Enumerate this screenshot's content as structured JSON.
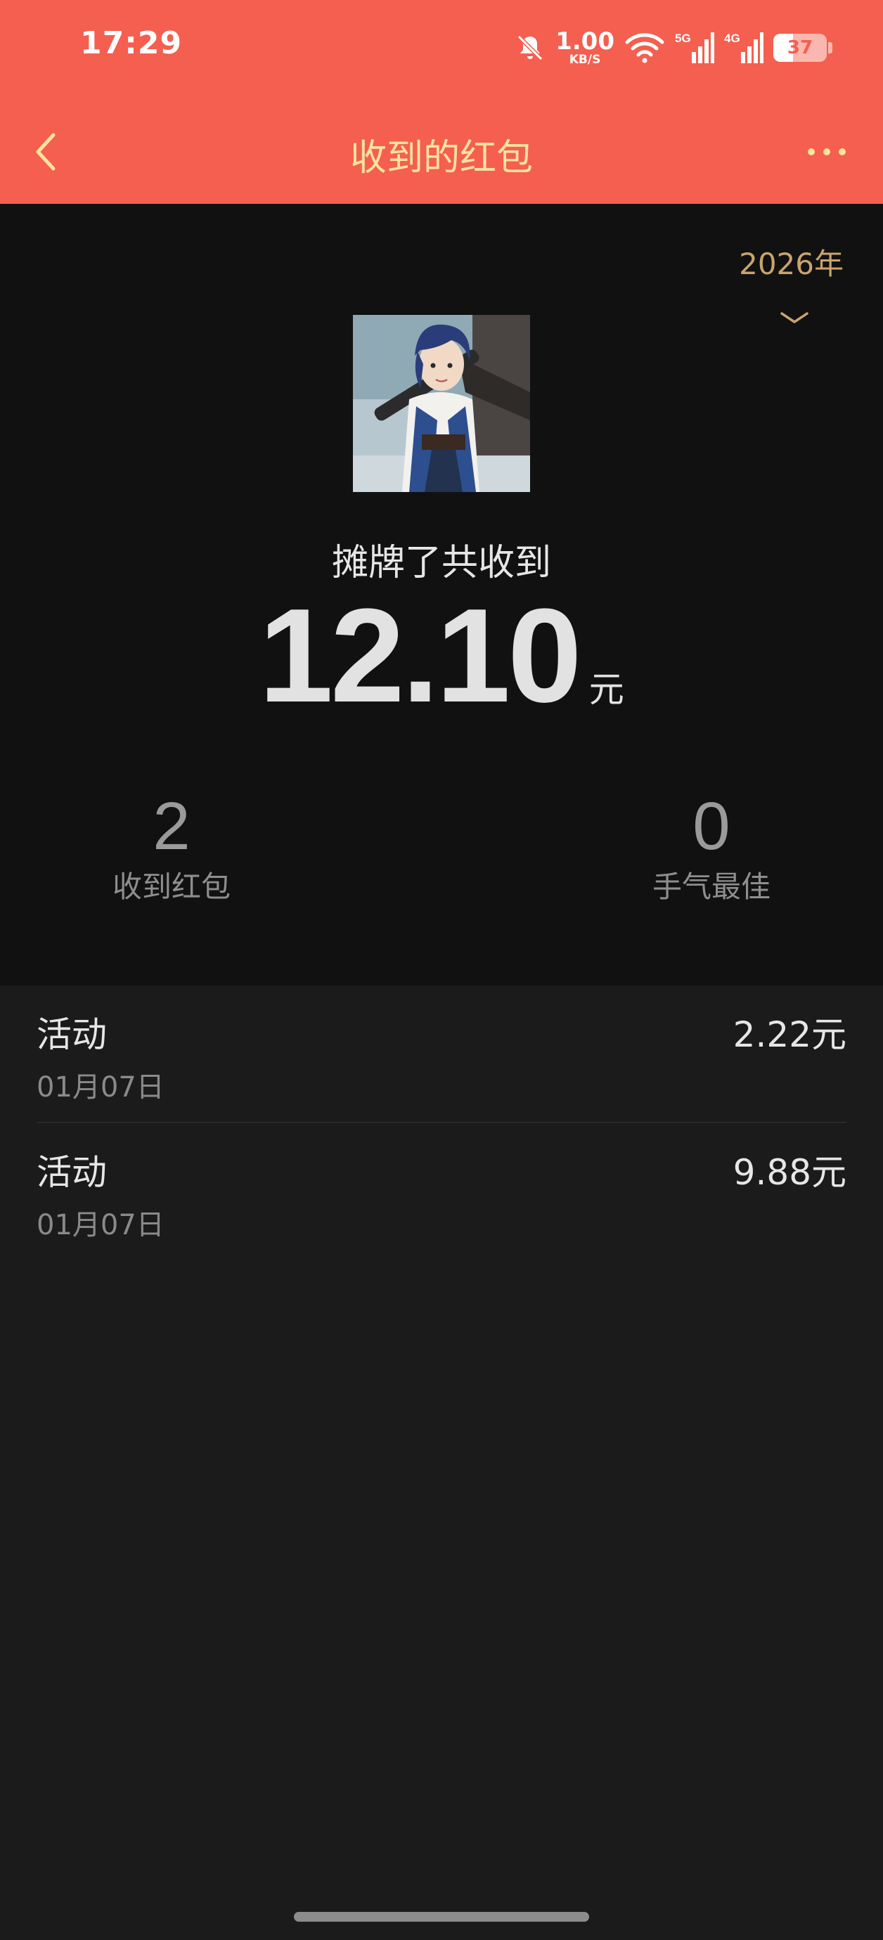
{
  "status_bar": {
    "time": "17:29",
    "net_speed": "1.00",
    "net_speed_unit": "KB/S",
    "signal_1": "5G",
    "signal_2": "4G",
    "battery": "37",
    "battery_level_percent": 37
  },
  "nav": {
    "title": "收到的红包",
    "back_icon": "chevron-left-icon",
    "more_icon": "more-dots-icon"
  },
  "summary": {
    "year": "2026年",
    "user_line": "摊牌了共收到",
    "total": "12.10",
    "unit": "元",
    "stats": [
      {
        "value": "2",
        "label": "收到红包"
      },
      {
        "value": "0",
        "label": "手气最佳"
      }
    ]
  },
  "records": [
    {
      "name": "活动",
      "date": "01月07日",
      "amount": "2.22元"
    },
    {
      "name": "活动",
      "date": "01月07日",
      "amount": "9.88元"
    }
  ],
  "colors": {
    "header_red": "#f45f4f",
    "gold": "#fde3a0",
    "year_gold": "#c9a46e",
    "summary_bg": "#111111",
    "list_bg": "#1b1b1b"
  }
}
